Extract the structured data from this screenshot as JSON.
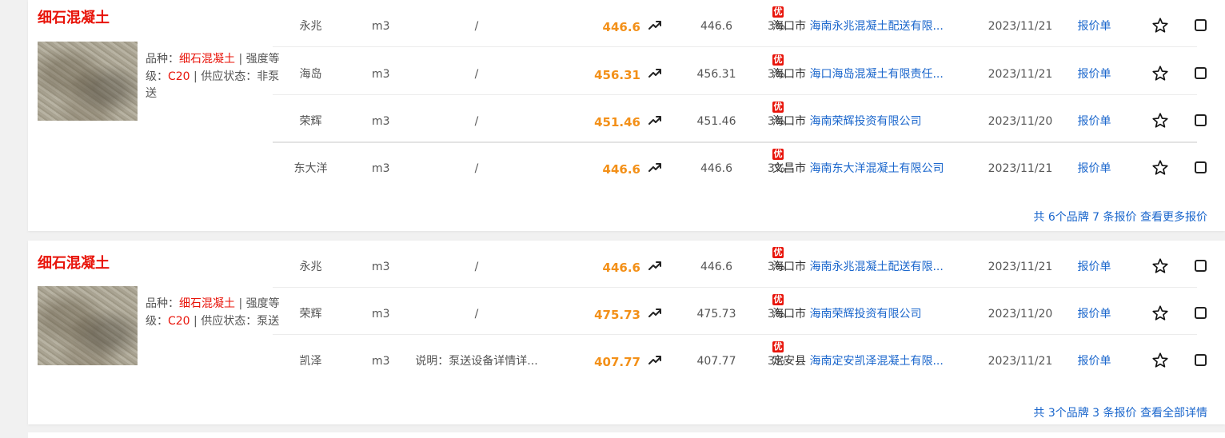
{
  "groups": [
    {
      "title": "细石混凝土",
      "spec": {
        "variety_label": "品种：",
        "variety": "细石混凝土",
        "sep1": " | ",
        "strength_label": "强度等级：",
        "strength": "C20",
        "sep2": " | ",
        "supply_label": "供应状态：",
        "supply": "非泵送"
      },
      "rows": [
        {
          "brand": "永兆",
          "unit": "m3",
          "note": "/",
          "price": "446.6",
          "base": "446.6",
          "tax": "3%",
          "badge": "优",
          "city": "海口市",
          "company": "海南永兆混凝土配送有限...",
          "date": "2023/11/21",
          "quote": "报价单"
        },
        {
          "brand": "海岛",
          "unit": "m3",
          "note": "/",
          "price": "456.31",
          "base": "456.31",
          "tax": "3%",
          "badge": "优",
          "city": "海口市",
          "company": "海口海岛混凝土有限责任...",
          "date": "2023/11/21",
          "quote": "报价单"
        },
        {
          "brand": "荣辉",
          "unit": "m3",
          "note": "/",
          "price": "451.46",
          "base": "451.46",
          "tax": "3%",
          "badge": "优",
          "city": "海口市",
          "company": "海南荣辉投资有限公司",
          "date": "2023/11/20",
          "quote": "报价单"
        },
        {
          "brand": "东大洋",
          "unit": "m3",
          "note": "/",
          "price": "446.6",
          "base": "446.6",
          "tax": "3%",
          "badge": "优",
          "city": "文昌市",
          "company": "海南东大洋混凝土有限公司",
          "date": "2023/11/21",
          "quote": "报价单"
        }
      ],
      "footer": {
        "summary": "共 6个品牌 7 条报价",
        "link": "查看更多报价"
      }
    },
    {
      "title": "细石混凝土",
      "spec": {
        "variety_label": "品种：",
        "variety": "细石混凝土",
        "sep1": " | ",
        "strength_label": "强度等级：",
        "strength": "C20",
        "sep2": " | ",
        "supply_label": "供应状态：",
        "supply": "泵送"
      },
      "rows": [
        {
          "brand": "永兆",
          "unit": "m3",
          "note": "/",
          "price": "446.6",
          "base": "446.6",
          "tax": "3%",
          "badge": "优",
          "city": "海口市",
          "company": "海南永兆混凝土配送有限...",
          "date": "2023/11/21",
          "quote": "报价单"
        },
        {
          "brand": "荣辉",
          "unit": "m3",
          "note": "/",
          "price": "475.73",
          "base": "475.73",
          "tax": "3%",
          "badge": "优",
          "city": "海口市",
          "company": "海南荣辉投资有限公司",
          "date": "2023/11/20",
          "quote": "报价单"
        },
        {
          "brand": "凯泽",
          "unit": "m3",
          "note": "说明：泵送设备详情详...",
          "price": "407.77",
          "base": "407.77",
          "tax": "3%",
          "badge": "优",
          "city": "定安县",
          "company": "海南定安凯泽混凝土有限...",
          "date": "2023/11/21",
          "quote": "报价单"
        }
      ],
      "footer": {
        "summary": "共 3个品牌 3 条报价",
        "link": "查看全部详情"
      }
    }
  ],
  "icons": {
    "trend": "trend-up-icon",
    "favorite": "star-outline-icon",
    "select": "checkbox-icon"
  },
  "colors": {
    "title_red": "#e8140a",
    "price_orange": "#f39018",
    "link_blue": "#1a66cc",
    "badge_red": "#e8140a"
  }
}
